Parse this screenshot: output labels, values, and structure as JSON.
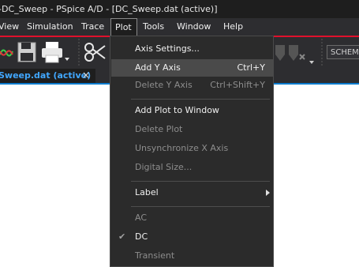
{
  "window": {
    "title": "-DC_Sweep - PSpice A/D  - [DC_Sweep.dat (active)]"
  },
  "menubar": {
    "items": [
      {
        "label": "View"
      },
      {
        "label": "Simulation"
      },
      {
        "label": "Trace"
      },
      {
        "label": "Plot"
      },
      {
        "label": "Tools"
      },
      {
        "label": "Window"
      },
      {
        "label": "Help"
      }
    ],
    "active": "Plot"
  },
  "toolbar": {
    "icons": [
      "waveform-icon",
      "save-icon",
      "print-icon",
      "cut-icon",
      "marker-icon",
      "marker-delete-icon"
    ],
    "schematic_combo": "SCHEM"
  },
  "tabs": [
    {
      "label": "Sweep.dat (active)",
      "close": "×"
    }
  ],
  "plot_menu": {
    "items": [
      {
        "label": "Axis Settings...",
        "shortcut": "",
        "enabled": true
      },
      {
        "label": "Add Y Axis",
        "shortcut": "Ctrl+Y",
        "enabled": true,
        "highlighted": true
      },
      {
        "label": "Delete Y Axis",
        "shortcut": "Ctrl+Shift+Y",
        "enabled": false
      },
      {
        "label": "Add Plot to Window",
        "shortcut": "",
        "enabled": true
      },
      {
        "label": "Delete Plot",
        "shortcut": "",
        "enabled": false
      },
      {
        "label": "Unsynchronize X Axis",
        "shortcut": "",
        "enabled": false
      },
      {
        "label": "Digital Size...",
        "shortcut": "",
        "enabled": false
      },
      {
        "label": "Label",
        "shortcut": "",
        "enabled": true,
        "submenu": true
      },
      {
        "label": "AC",
        "shortcut": "",
        "enabled": false
      },
      {
        "label": "DC",
        "shortcut": "",
        "enabled": true,
        "checked": true
      },
      {
        "label": "Transient",
        "shortcut": "",
        "enabled": false
      }
    ],
    "check_glyph": "✔"
  },
  "colors": {
    "accent_red": "#e0102c",
    "tab_text": "#41a7ff",
    "menu_bg": "#2b2b2b",
    "highlight": "#4a4a4a"
  }
}
